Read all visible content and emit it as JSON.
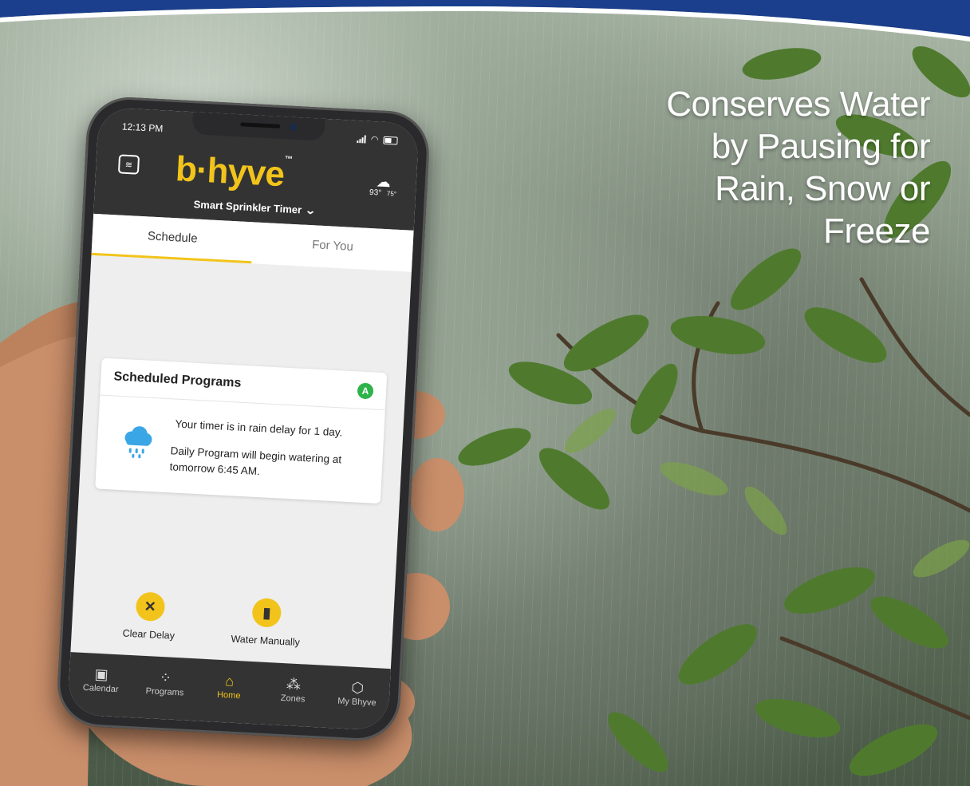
{
  "headline": "Conserves Water\nby Pausing for\nRain, Snow or\nFreeze",
  "phone": {
    "status": {
      "time": "12:13 PM"
    },
    "header": {
      "logo": "b·hyve",
      "logo_tm": "™",
      "weather_hi": "93°",
      "weather_lo": "75°",
      "device_name": "Smart Sprinkler Timer",
      "chevron": "⌄"
    },
    "tabs": [
      {
        "label": "Schedule",
        "active": true
      },
      {
        "label": "For You",
        "active": false
      }
    ],
    "card": {
      "title": "Scheduled Programs",
      "badge": "A",
      "message_1": "Your timer is in  rain delay for 1 day.",
      "message_2": "Daily Program will begin watering at tomorrow 6:45 AM."
    },
    "actions": {
      "clear_delay": "Clear Delay",
      "clear_icon": "✕",
      "water_manually": "Water Manually",
      "water_icon": "▮"
    },
    "nav": [
      {
        "label": "Calendar",
        "icon": "calendar-icon"
      },
      {
        "label": "Programs",
        "icon": "programs-icon"
      },
      {
        "label": "Home",
        "icon": "home-icon",
        "active": true
      },
      {
        "label": "Zones",
        "icon": "zones-icon"
      },
      {
        "label": "My Bhyve",
        "icon": "my-bhyve-icon"
      }
    ]
  },
  "colors": {
    "accent": "#f2c41b",
    "header_bg": "#333333",
    "badge_green": "#2eb34a",
    "band_blue": "#1b3f8c"
  }
}
